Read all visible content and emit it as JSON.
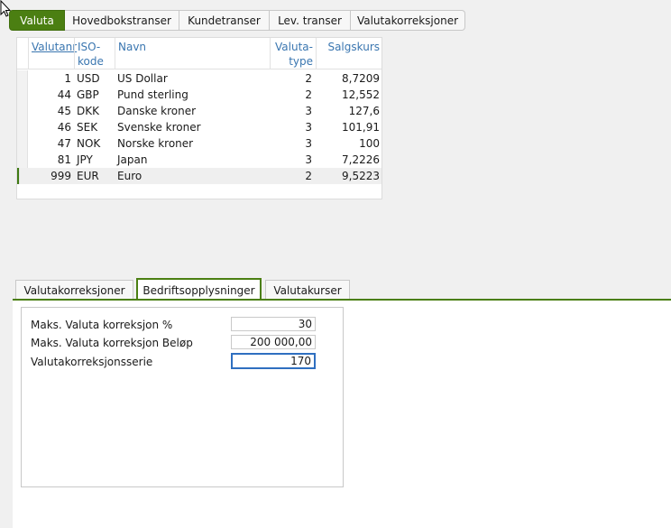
{
  "top_tabs": [
    "Valuta",
    "Hovedbokstranser",
    "Kundetranser",
    "Lev. transer",
    "Valutakorreksjoner"
  ],
  "grid": {
    "headers": {
      "valutanr": "Valutanr",
      "iso_line1": "ISO-",
      "iso_line2": "kode",
      "navn": "Navn",
      "type_line1": "Valuta-",
      "type_line2": "type",
      "salgskurs": "Salgskurs"
    },
    "rows": [
      {
        "nr": "1",
        "iso": "USD",
        "navn": "US Dollar",
        "type": "2",
        "kurs": "8,7209"
      },
      {
        "nr": "44",
        "iso": "GBP",
        "navn": "Pund sterling",
        "type": "2",
        "kurs": "12,552"
      },
      {
        "nr": "45",
        "iso": "DKK",
        "navn": "Danske kroner",
        "type": "3",
        "kurs": "127,6"
      },
      {
        "nr": "46",
        "iso": "SEK",
        "navn": "Svenske kroner",
        "type": "3",
        "kurs": "101,91"
      },
      {
        "nr": "47",
        "iso": "NOK",
        "navn": "Norske kroner",
        "type": "3",
        "kurs": "100"
      },
      {
        "nr": "81",
        "iso": "JPY",
        "navn": "Japan",
        "type": "3",
        "kurs": "7,2226"
      },
      {
        "nr": "999",
        "iso": "EUR",
        "navn": "Euro",
        "type": "2",
        "kurs": "9,5223"
      }
    ]
  },
  "bottom_tabs": [
    "Valutakorreksjoner",
    "Bedriftsopplysninger",
    "Valutakurser"
  ],
  "form": {
    "fields": [
      {
        "label": "Maks. Valuta korreksjon %",
        "value": "30"
      },
      {
        "label": "Maks. Valuta korreksjon Beløp",
        "value": "200 000,00"
      },
      {
        "label": "Valutakorreksjonsserie",
        "value": "170"
      }
    ]
  },
  "colors": {
    "accent": "#4b7f12",
    "link": "#3a76b0",
    "focus": "#2f6fc0"
  }
}
